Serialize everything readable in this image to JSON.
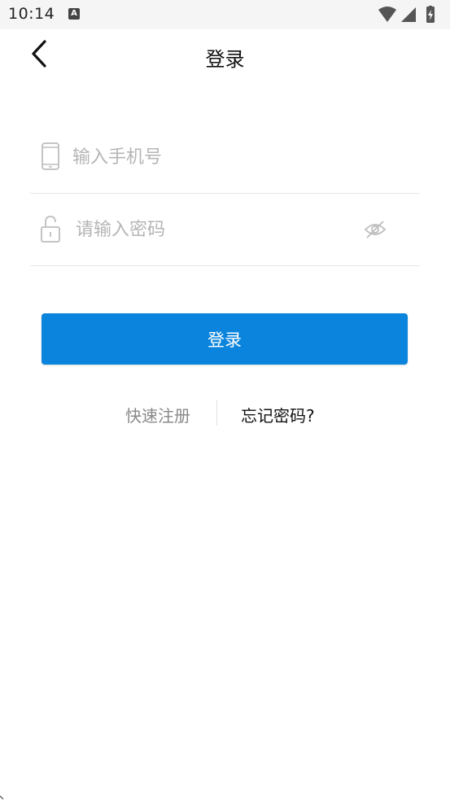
{
  "status_bar": {
    "time": "10:14",
    "notification_icon_letter": "A",
    "icons": [
      "wifi-icon",
      "signal-icon",
      "battery-icon"
    ]
  },
  "header": {
    "title": "登录",
    "back_icon": "chevron-left-icon"
  },
  "form": {
    "phone": {
      "placeholder": "输入手机号",
      "value": "",
      "icon": "phone-icon"
    },
    "password": {
      "placeholder": "请输入密码",
      "value": "",
      "icon": "unlock-icon",
      "toggle_icon": "eye-hidden-icon"
    },
    "submit_label": "登录"
  },
  "links": {
    "register": "快速注册",
    "forgot": "忘记密码?"
  },
  "colors": {
    "primary": "#0a84dc",
    "placeholder": "#b5b5b5",
    "divider": "#e6e6e6"
  }
}
